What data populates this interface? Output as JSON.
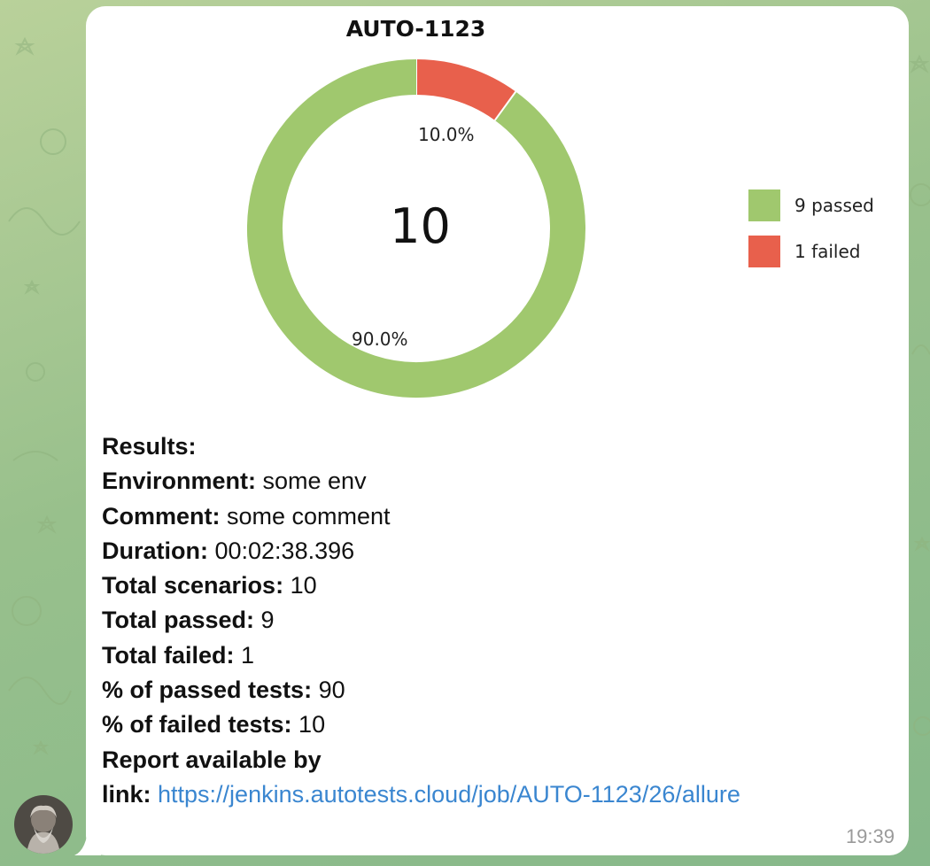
{
  "chart_data": {
    "type": "pie",
    "title": "AUTO-1123",
    "center_label": "10",
    "categories": [
      "9 passed",
      "1 failed"
    ],
    "values": [
      90.0,
      10.0
    ],
    "percent_labels": [
      "90.0%",
      "10.0%"
    ],
    "colors": [
      "#a0c86e",
      "#e8604c"
    ],
    "legend_position": "right"
  },
  "message": {
    "lines": [
      {
        "key": "Results:",
        "value": ""
      },
      {
        "key": "Environment:",
        "value": " some env"
      },
      {
        "key": "Comment:",
        "value": " some comment"
      },
      {
        "key": "Duration:",
        "value": " 00:02:38.396"
      },
      {
        "key": "Total scenarios:",
        "value": " 10"
      },
      {
        "key": "Total passed:",
        "value": " 9"
      },
      {
        "key": "Total failed:",
        "value": " 1"
      },
      {
        "key": "% of passed tests:",
        "value": " 90"
      },
      {
        "key": "% of failed tests:",
        "value": " 10"
      },
      {
        "key": "Report available by",
        "value": ""
      }
    ],
    "link_prefix": "link: ",
    "link_text": "https://jenkins.autotests.cloud/job/AUTO-1123/26/allure",
    "time": "19:39"
  },
  "avatar_icon": "user-avatar-icon"
}
